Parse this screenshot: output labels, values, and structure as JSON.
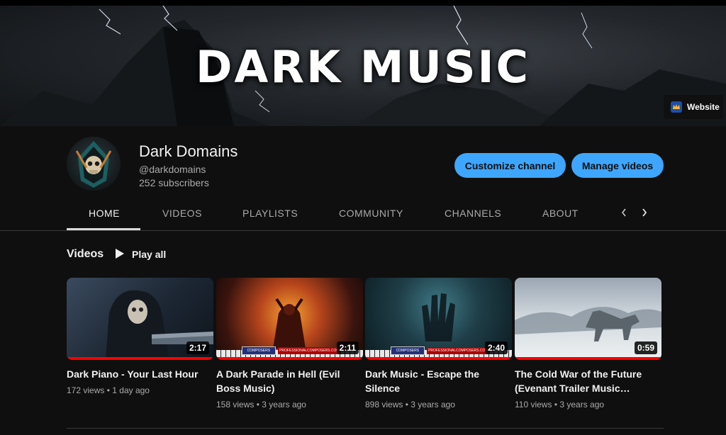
{
  "banner": {
    "title": "DARK MUSIC",
    "website_label": "Website"
  },
  "channel": {
    "name": "Dark Domains",
    "handle": "@darkdomains",
    "subscribers": "252 subscribers"
  },
  "actions": {
    "customize_label": "Customize channel",
    "manage_label": "Manage videos"
  },
  "tabs": [
    {
      "label": "HOME",
      "active": true
    },
    {
      "label": "VIDEOS"
    },
    {
      "label": "PLAYLISTS"
    },
    {
      "label": "COMMUNITY"
    },
    {
      "label": "CHANNELS"
    },
    {
      "label": "ABOUT"
    }
  ],
  "section": {
    "title": "Videos",
    "play_all_label": "Play all"
  },
  "videos": [
    {
      "title": "Dark Piano - Your Last Hour",
      "title2": "",
      "duration": "2:17",
      "views": "172 views",
      "age": "1 day ago"
    },
    {
      "title": "A Dark Parade in Hell (Evil",
      "title2": "Boss Music)",
      "duration": "2:11",
      "views": "158 views",
      "age": "3 years ago",
      "strip_left": "COMPOSERS",
      "strip_right": "PROFESSIONALCOMPOSERS.COM"
    },
    {
      "title": "Dark Music - Escape the",
      "title2": "Silence",
      "duration": "2:40",
      "views": "898 views",
      "age": "3 years ago",
      "strip_left": "COMPOSERS",
      "strip_right": "PROFESSIONALCOMPOSERS.COM"
    },
    {
      "title": "The Cold War of the Future",
      "title2": "(Evenant Trailer Music…",
      "duration": "0:59",
      "views": "110 views",
      "age": "3 years ago"
    }
  ],
  "meta_separator": "•",
  "colors": {
    "background": "#0f0f0f",
    "accent_button": "#3ea6ff",
    "progress": "#ff0000",
    "secondary_text": "#aaaaaa"
  },
  "icons": {
    "play": "play-icon",
    "chevron_left": "chevron-left-icon",
    "chevron_right": "chevron-right-icon",
    "website": "website-favicon-icon"
  }
}
